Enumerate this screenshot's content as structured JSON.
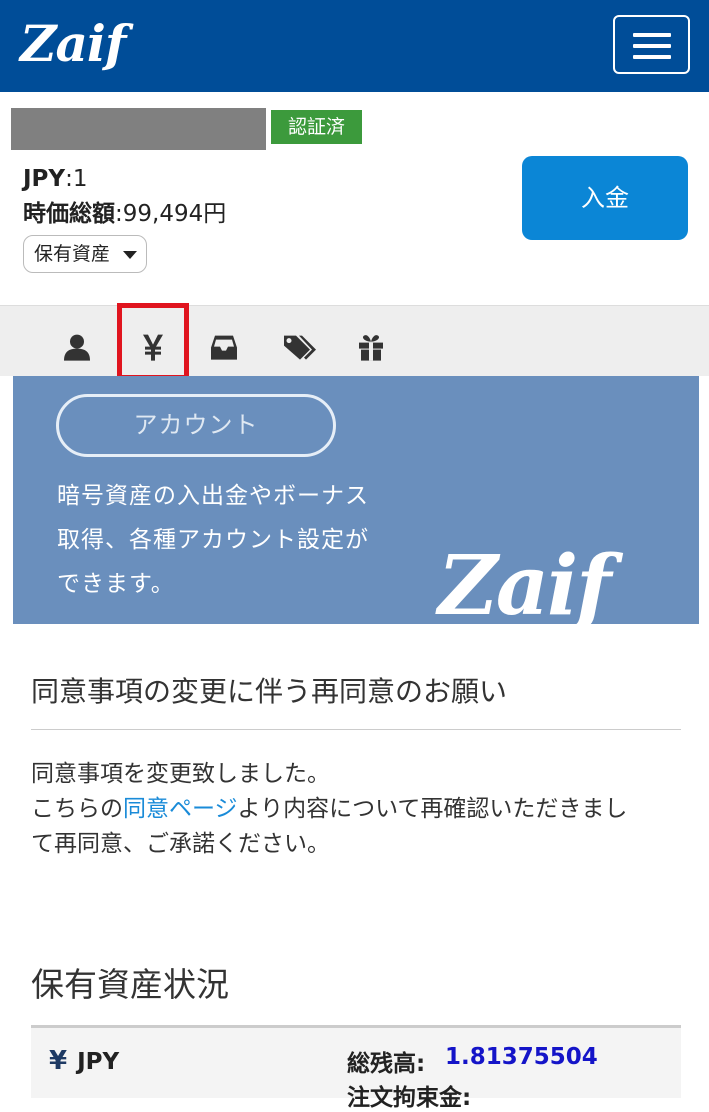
{
  "header": {
    "logo_text": "Zaif",
    "menu_icon": "hamburger-icon",
    "bg_color": "#004d98"
  },
  "account": {
    "verified_label": "認証済",
    "jpy_label": "JPY",
    "jpy_value": ":1",
    "total_label": "時価総額",
    "total_value": ":99,494円",
    "assets_dropdown_label": "保有資産",
    "deposit_button_label": "入金"
  },
  "tabs": [
    {
      "icon": "user-icon"
    },
    {
      "icon": "yen-icon",
      "highlighted": true
    },
    {
      "icon": "inbox-icon"
    },
    {
      "icon": "tags-icon"
    },
    {
      "icon": "gift-icon"
    }
  ],
  "banner": {
    "account_button_label": "アカウント",
    "description_lines": [
      "暗号資産の入出金やボーナス",
      "取得、各種アカウント設定が",
      "できます。"
    ],
    "logo_text": "Zaif",
    "bg_color": "#6a8fbd"
  },
  "notice": {
    "title": "同意事項の変更に伴う再同意のお願い",
    "line1": "同意事項を変更致しました。",
    "line2_prefix": "こちらの",
    "link_text": "同意ページ",
    "line2_suffix": "より内容について再確認いただきまし",
    "line3": "て再同意、ご承諾ください。"
  },
  "assets": {
    "title": "保有資産状況",
    "rows": [
      {
        "currency_icon": "¥",
        "currency": "JPY",
        "total_label": "総残高:",
        "total_value": "1.81375504",
        "order_label": "注文拘束金:"
      }
    ]
  },
  "colors": {
    "highlight": "#e0141e",
    "deposit": "#0b86d6",
    "verified": "#3c9a3c",
    "link": "#1a8bd8",
    "amount": "#1414c8"
  }
}
